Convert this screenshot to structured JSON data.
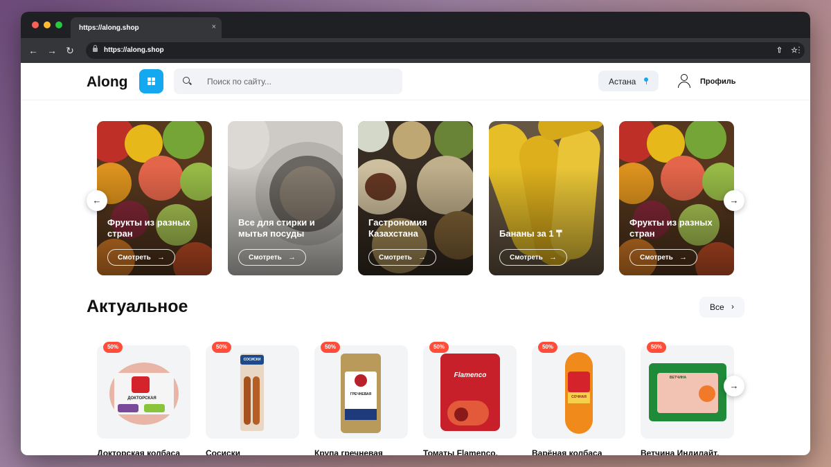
{
  "browser": {
    "tab_title": "https://along.shop",
    "tab_close": "×",
    "url": "https://along.shop",
    "nav": {
      "back": "←",
      "forward": "→",
      "reload": "↻"
    },
    "icons": {
      "share": "⇧",
      "bookmark": "☆",
      "menu": "⋮"
    },
    "traffic_lights": [
      "#fe5f57",
      "#febc2e",
      "#28c840"
    ]
  },
  "header": {
    "logo": "Along",
    "search": {
      "placeholder": "Поиск по сайту..."
    },
    "city": "Астана",
    "profile": "Профиль",
    "accent": "#13a8f0"
  },
  "banners": {
    "items": [
      {
        "title": "Фрукты из разных стран",
        "cta": "Смотреть",
        "arrow": "→",
        "theme": "fruits"
      },
      {
        "title": "Все для стирки и мытья посуды",
        "cta": "Смотреть",
        "arrow": "→",
        "theme": "laundry"
      },
      {
        "title": "Гастрономия Казахстана",
        "cta": "Смотреть",
        "arrow": "→",
        "theme": "food"
      },
      {
        "title": "Бананы за 1 ₸",
        "cta": "Смотреть",
        "arrow": "→",
        "theme": "bananas"
      },
      {
        "title": "Фрукты из разных стран",
        "cta": "Смотреть",
        "arrow": "→",
        "theme": "fruits"
      }
    ],
    "prev": "←",
    "next": "→"
  },
  "actual": {
    "title": "Актуальное",
    "all_label": "Все",
    "all_chevron": "›",
    "next": "→",
    "discount_color": "#ff4d3a",
    "products": [
      {
        "badge": "50%",
        "name": "Докторская колбаса",
        "pack_text": "ДОКТОРСКАЯ"
      },
      {
        "badge": "50%",
        "name": "Сосиски",
        "pack_text": "СОСИСКИ"
      },
      {
        "badge": "50%",
        "name": "Крупа гречневая",
        "pack_text": "ГРЕЧНЕВАЯ"
      },
      {
        "badge": "50%",
        "name": "Томаты Flamenco,",
        "pack_text": "Flamenco"
      },
      {
        "badge": "50%",
        "name": "Варёная колбаса",
        "pack_text": "СОЧНАЯ"
      },
      {
        "badge": "50%",
        "name": "Ветчина Индилайт,",
        "pack_text": "ВЕТЧИНА"
      }
    ]
  }
}
